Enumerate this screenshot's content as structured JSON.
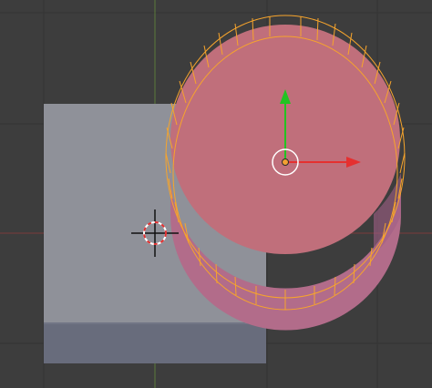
{
  "viewport": {
    "view": "top-orthographic",
    "background": "#3d3d3d",
    "grid_color": "#333333",
    "x_axis_color": "#7a3a3a",
    "y_axis_color": "#5a7a3a"
  },
  "objects": [
    {
      "name": "Cube",
      "state": "unselected",
      "color": "#8f9199",
      "side_color": "#686c7c"
    },
    {
      "name": "Cylinder",
      "state": "selected",
      "color": "#c06f7b",
      "side_color": "#b26c8a",
      "outline_color": "#f6a42c"
    }
  ],
  "cursor": {
    "icon": "3d-cursor-icon"
  },
  "gizmo": {
    "type": "translate",
    "x_color": "#e53030",
    "y_color": "#22c422",
    "origin_color": "#f3a033"
  }
}
